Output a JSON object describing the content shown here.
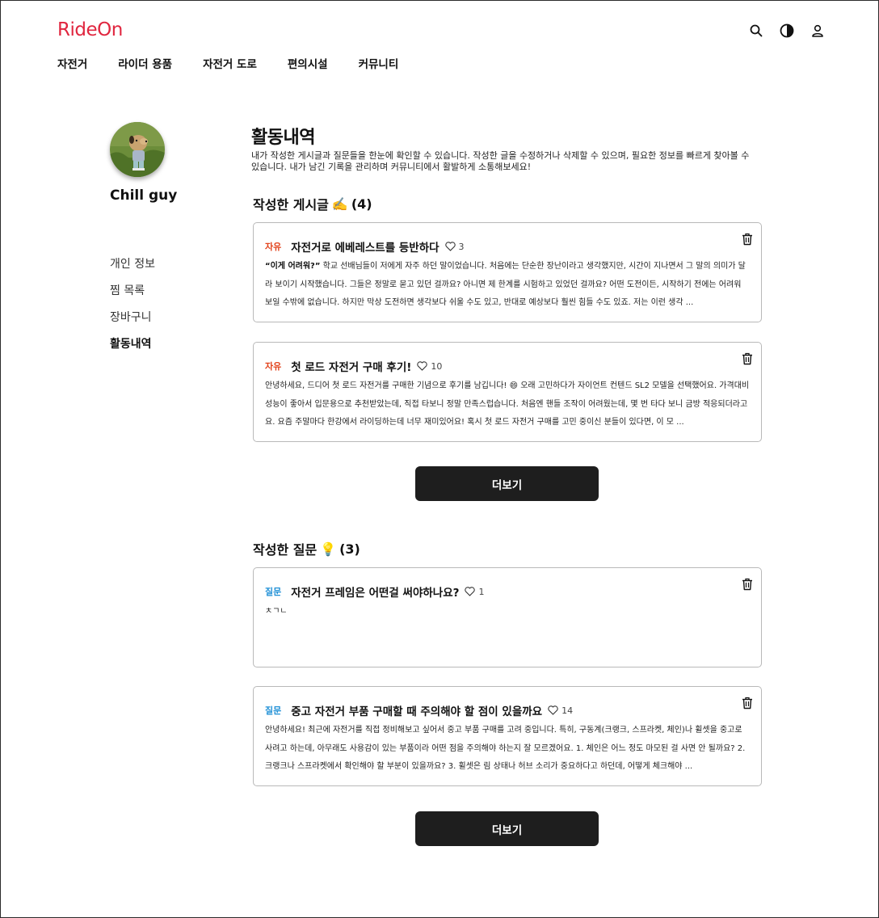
{
  "brand": {
    "logo": "RideOn",
    "accent": "#e0263f"
  },
  "header_icons": [
    "search-icon",
    "contrast-icon",
    "user-icon"
  ],
  "nav": [
    "자전거",
    "라이더 용품",
    "자전거 도로",
    "편의시설",
    "커뮤니티"
  ],
  "profile": {
    "name": "Chill guy"
  },
  "side_menu": [
    "개인 정보",
    "찜 목록",
    "장바구니",
    "활동내역"
  ],
  "page": {
    "title": "활동내역",
    "description": "내가 작성한 게시글과 질문들을 한눈에 확인할 수 있습니다. 작성한 글을 수정하거나 삭제할 수 있으며, 필요한 정보를 빠르게 찾아볼 수 있습니다. 내가 남긴 기록을 관리하며 커뮤니티에서 활발하게 소통해보세요!"
  },
  "posts": {
    "title": "작성한 게시글",
    "emoji": "✍️",
    "count": "(4)",
    "items": [
      {
        "tag": "자유",
        "title": "자전거로 에베레스트를 등반하다",
        "likes": "3",
        "body_bold": "“이게 어려워?”",
        "body": " 학교 선배님들이 저에게 자주 하던 말이었습니다. 처음에는 단순한 장난이라고 생각했지만, 시간이 지나면서 그 말의 의미가 달라 보이기 시작했습니다. 그들은 정말로 묻고 있던 걸까요? 아니면 제 한계를 시험하고 있었던 걸까요? 어떤 도전이든, 시작하기 전에는 어려워 보일 수밖에 없습니다. 하지만 막상 도전하면 생각보다 쉬울 수도 있고, 반대로 예상보다 훨씬 힘들 수도 있죠. 저는 이런 생각 ..."
      },
      {
        "tag": "자유",
        "title": "첫 로드 자전거 구매 후기!",
        "likes": "10",
        "body_bold": "",
        "body": "안녕하세요, 드디어 첫 로드 자전거를 구매한 기념으로 후기를 남깁니다! 😄 오래 고민하다가 자이언트 컨텐드 SL2 모델을 선택했어요. 가격대비 성능이 좋아서 입문용으로 추천받았는데, 직접 타보니 정말 만족스럽습니다. 처음엔 핸들 조작이 어려웠는데, 몇 번 타다 보니 금방 적응되더라고요. 요즘 주말마다 한강에서 라이딩하는데 너무 재미있어요! 혹시 첫 로드 자전거 구매를 고민 중이신 분들이 있다면, 이 모 ..."
      }
    ],
    "more_label": "더보기"
  },
  "questions": {
    "title": "작성한 질문",
    "emoji": "💡",
    "count": "(3)",
    "items": [
      {
        "tag": "질문",
        "title": "자전거 프레임은 어떤걸 써야하나요?",
        "likes": "1",
        "body_bold": "",
        "body": "ㅊㄱㄴ"
      },
      {
        "tag": "질문",
        "title": "중고 자전거 부품 구매할 때 주의해야 할 점이 있을까요",
        "likes": "14",
        "body_bold": "",
        "body": "안녕하세요! 최근에 자전거를 직접 정비해보고 싶어서 중고 부품 구매를 고려 중입니다. 특히, 구동계(크랭크, 스프라켓, 체인)나 휠셋을 중고로 사려고 하는데, 아무래도 사용감이 있는 부품이라 어떤 점을 주의해야 하는지 잘 모르겠어요. 1. 체인은 어느 정도 마모된 걸 사면 안 될까요? 2. 크랭크나 스프라켓에서 확인해야 할 부분이 있을까요? 3. 휠셋은 림 상태나 허브 소리가 중요하다고 하던데, 어떻게 체크해야 ..."
      }
    ],
    "more_label": "더보기"
  }
}
